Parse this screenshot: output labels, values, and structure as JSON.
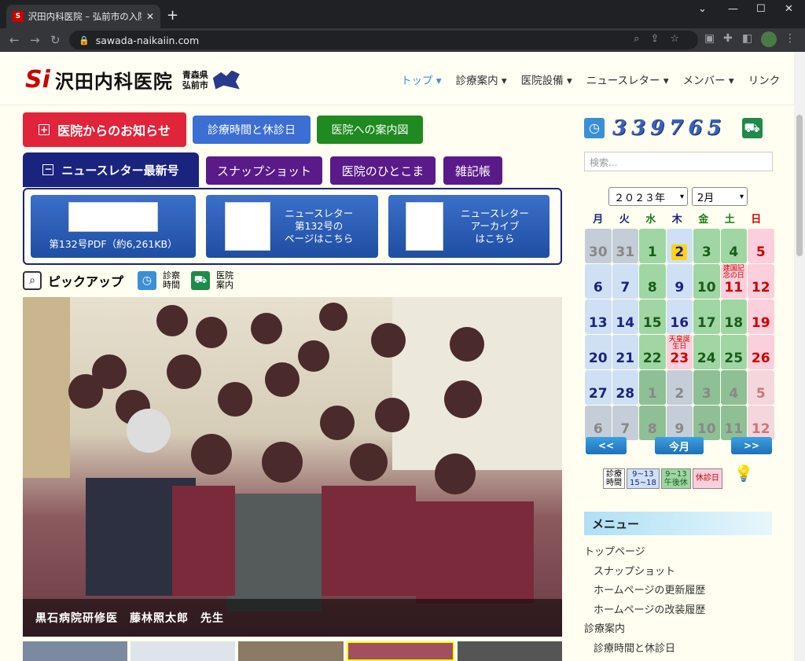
{
  "browser": {
    "tab_title": "沢田内科医院 – 弘前市の入院設備",
    "url": "sawada-naikaiin.com"
  },
  "header": {
    "logo_mark": "Si",
    "logo_name": "沢田内科医院",
    "pref1": "青森県",
    "pref2": "弘前市"
  },
  "nav": [
    "トップ ▾",
    "診療案内 ▾",
    "医院設備 ▾",
    "ニュースレター ▾",
    "メンバー ▾",
    "リンク"
  ],
  "buttons": {
    "notice": "医院からのお知らせ",
    "hours": "診療時間と休診日",
    "map": "医院への案内図",
    "newsletter": "ニュースレター最新号",
    "snapshot": "スナップショット",
    "hitokoma": "医院のひとこま",
    "zakki": "雑記帳"
  },
  "newsletter_box": {
    "pdf": "第132号PDF（約6,261KB）",
    "page1": "ニュースレター",
    "page2": "第132号の",
    "page3": "ページはこちら",
    "arc1": "ニュースレター",
    "arc2": "アーカイブ",
    "arc3": "はこちら"
  },
  "pickup": {
    "title": "ピックアップ",
    "hours1": "診察",
    "hours2": "時間",
    "guide1": "医院",
    "guide2": "案内"
  },
  "photo_caption": "黒石病院研修医　藤林照太郎　先生",
  "sidebar": {
    "counter": "339765",
    "search_placeholder": "検索...",
    "year": "２０２３年",
    "month": "2月",
    "today": "今月",
    "prev": "<<",
    "next": ">>",
    "legend": {
      "l1a": "診療",
      "l1b": "時間",
      "l2a": "9~13",
      "l2b": "15~18",
      "l3a": "9~13",
      "l3b": "午後休",
      "l4": "休診日"
    },
    "menu_title": "メニュー",
    "menu": [
      "トップページ",
      "スナップショット",
      "ホームページの更新履歴",
      "ホームページの改装履歴",
      "診療案内",
      "診療時間と休診日"
    ]
  },
  "calendar": {
    "weekdays": [
      "月",
      "火",
      "水",
      "木",
      "金",
      "土",
      "日"
    ],
    "days": [
      [
        "30",
        "31",
        "1",
        "2",
        "3",
        "4",
        "5"
      ],
      [
        "6",
        "7",
        "8",
        "9",
        "10",
        "11",
        "12"
      ],
      [
        "13",
        "14",
        "15",
        "16",
        "17",
        "18",
        "19"
      ],
      [
        "20",
        "21",
        "22",
        "23",
        "24",
        "25",
        "26"
      ],
      [
        "27",
        "28",
        "1",
        "2",
        "3",
        "4",
        "5"
      ],
      [
        "6",
        "7",
        "8",
        "9",
        "10",
        "11",
        "12"
      ]
    ],
    "notes": {
      "11": "建国記念の日",
      "23": "天皇誕生日"
    }
  },
  "colors": {
    "notice": "#e0243a",
    "hours": "#3b6fd4",
    "map": "#1f8a1f",
    "newsletter": "#1a237e",
    "purple": "#5a1a8a"
  }
}
